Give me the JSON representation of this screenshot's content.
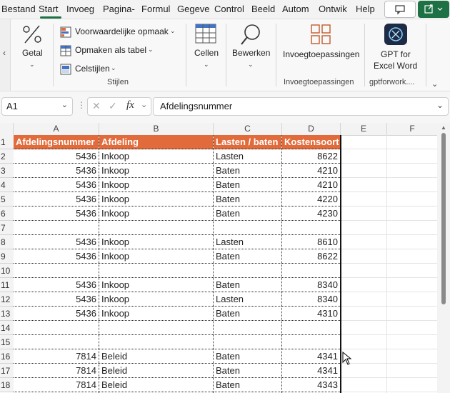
{
  "ribbon_tabs": [
    "Bestand",
    "Start",
    "Invoeg",
    "Pagina-",
    "Formul",
    "Gegeve",
    "Control",
    "Beeld",
    "Autom",
    "Ontwik",
    "Help"
  ],
  "ribbon": {
    "getal_label": "Getal",
    "stijlen_items": [
      "Voorwaardelijke opmaak",
      "Opmaken als tabel",
      "Celstijlen"
    ],
    "stijlen_group": "Stijlen",
    "cellen_label": "Cellen",
    "bewerken_label": "Bewerken",
    "invoeg_label": "Invoegtoepassingen",
    "invoeg_group": "Invoegtoepassingen",
    "gpt_label_1": "GPT for",
    "gpt_label_2": "Excel Word",
    "gpt_group": "gptforwork...."
  },
  "formula_bar": {
    "name_box": "A1",
    "fx": "fx",
    "content": "Afdelingsnummer"
  },
  "columns": [
    "A",
    "B",
    "C",
    "D",
    "E",
    "F"
  ],
  "header": [
    "Afdelingsnummer",
    "Afdeling",
    "Lasten / baten",
    "Kostensoort"
  ],
  "rows": [
    {
      "n": "2",
      "a": "5436",
      "b": "Inkoop",
      "c": "Lasten",
      "d": "8622"
    },
    {
      "n": "3",
      "a": "5436",
      "b": "Inkoop",
      "c": "Baten",
      "d": "4210"
    },
    {
      "n": "4",
      "a": "5436",
      "b": "Inkoop",
      "c": "Baten",
      "d": "4210"
    },
    {
      "n": "5",
      "a": "5436",
      "b": "Inkoop",
      "c": "Baten",
      "d": "4220"
    },
    {
      "n": "6",
      "a": "5436",
      "b": "Inkoop",
      "c": "Baten",
      "d": "4230"
    },
    {
      "n": "7",
      "a": "",
      "b": "",
      "c": "",
      "d": ""
    },
    {
      "n": "8",
      "a": "5436",
      "b": "Inkoop",
      "c": "Lasten",
      "d": "8610"
    },
    {
      "n": "9",
      "a": "5436",
      "b": "Inkoop",
      "c": "Baten",
      "d": "8622"
    },
    {
      "n": "10",
      "a": "",
      "b": "",
      "c": "",
      "d": ""
    },
    {
      "n": "11",
      "a": "5436",
      "b": "Inkoop",
      "c": "Baten",
      "d": "8340"
    },
    {
      "n": "12",
      "a": "5436",
      "b": "Inkoop",
      "c": "Lasten",
      "d": "8340"
    },
    {
      "n": "13",
      "a": "5436",
      "b": "Inkoop",
      "c": "Baten",
      "d": "4310"
    },
    {
      "n": "14",
      "a": "",
      "b": "",
      "c": "",
      "d": ""
    },
    {
      "n": "15",
      "a": "",
      "b": "",
      "c": "",
      "d": ""
    },
    {
      "n": "16",
      "a": "7814",
      "b": "Beleid",
      "c": "Baten",
      "d": "4341"
    },
    {
      "n": "17",
      "a": "7814",
      "b": "Beleid",
      "c": "Baten",
      "d": "4341"
    },
    {
      "n": "18",
      "a": "7814",
      "b": "Beleid",
      "c": "Baten",
      "d": "4343"
    }
  ],
  "colors": {
    "header_fill": "#e26b3b",
    "accent": "#1e7145"
  }
}
